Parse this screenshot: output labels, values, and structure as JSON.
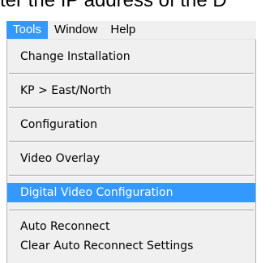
{
  "top_text": "ter the IP address of the D",
  "menubar": {
    "items": [
      "Tools",
      "Window",
      "Help"
    ],
    "active": "Tools"
  },
  "menu": {
    "items": [
      {
        "label": "Change Installation"
      },
      {
        "label": "KP > East/North"
      },
      {
        "label": "Configuration"
      },
      {
        "label": "Video Overlay"
      },
      {
        "label": "Digital Video Configuration",
        "highlighted": true
      },
      {
        "label": "Auto Reconnect"
      },
      {
        "label": "Clear Auto Reconnect Settings"
      }
    ]
  },
  "colors": {
    "highlight": "#3399ff",
    "menu_bg": "#f0f0f0"
  }
}
